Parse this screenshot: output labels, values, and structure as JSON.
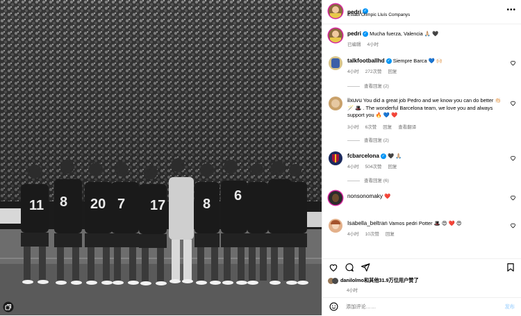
{
  "header": {
    "username": "pedri",
    "location": "Estadi Olímpic Lluís Companys",
    "more": "•••"
  },
  "caption": {
    "username": "pedri",
    "text": "Mucha fuerza, Valencia 🙏🏼 🖤",
    "edited": "已编辑",
    "time": "4小时"
  },
  "comments": [
    {
      "username": "talkfootballhd",
      "verified": true,
      "text": "Siempre Barca 💙 🙌🏻",
      "time": "4小时",
      "likes": "272次赞",
      "reply": "回复",
      "view_replies": "查看回复 (2)"
    },
    {
      "username": "iixuvu",
      "verified": false,
      "text": "You did a great job Pedro and we know you can do better 👏🏻 🪄 🎩 . The wonderful Barcelona team, we love you and always support you 🔥 💙 ❤️",
      "time": "3小时",
      "likes": "6次赞",
      "reply": "回复",
      "translate": "查看翻译",
      "view_replies": "查看回复 (2)"
    },
    {
      "username": "fcbarcelona",
      "verified": true,
      "text": "🖤 🙏🏼",
      "time": "4小时",
      "likes": "504次赞",
      "reply": "回复",
      "view_replies": "查看回复 (6)"
    },
    {
      "username": "nonsonomaky",
      "verified": false,
      "text": "❤️",
      "time": "",
      "likes": "",
      "reply": ""
    },
    {
      "username": "Isabella_beltran",
      "verified": false,
      "text": "Vamos pedri Potter 🎩 😍 ❤️ 😍",
      "time": "4小时",
      "likes": "10次赞",
      "reply": "回复"
    }
  ],
  "likes": {
    "user": "danilolmo",
    "rest": "和其他31.9万位用户赞了"
  },
  "post_time": "4小时",
  "add_comment": {
    "placeholder": "添加评论……",
    "post_label": "发布"
  },
  "colors": {
    "verified": "#0095f6",
    "muted": "#737373",
    "border": "#efefef",
    "post_button": "#b3dbff"
  },
  "icons": [
    "heart-icon",
    "comment-icon",
    "share-icon",
    "bookmark-icon",
    "emoji-icon",
    "verified-icon",
    "multi-post-icon"
  ]
}
